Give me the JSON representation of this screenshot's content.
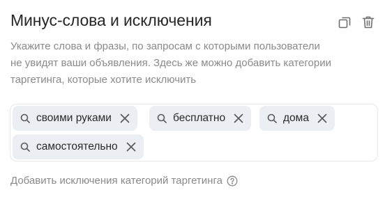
{
  "section": {
    "title": "Минус-слова и исключения",
    "description_lines": [
      "Укажите слова и фразы, по запросам с которыми пользователи",
      "не увидят ваши объявления. Здесь же можно добавить категории",
      "таргетинга, которые хотите исключить"
    ]
  },
  "actions": {
    "copy_icon": "copy-icon",
    "delete_icon": "trash-icon"
  },
  "chips": [
    {
      "label": "своими руками"
    },
    {
      "label": "бесплатно"
    },
    {
      "label": "дома"
    },
    {
      "label": "самостоятельно"
    }
  ],
  "add_exclusion": {
    "label": "Добавить исключения категорий таргетинга",
    "icon": "help-icon"
  },
  "colors": {
    "chip_bg": "#ebeef2",
    "muted_text": "#8a8a8a",
    "border": "#e6e8eb"
  }
}
